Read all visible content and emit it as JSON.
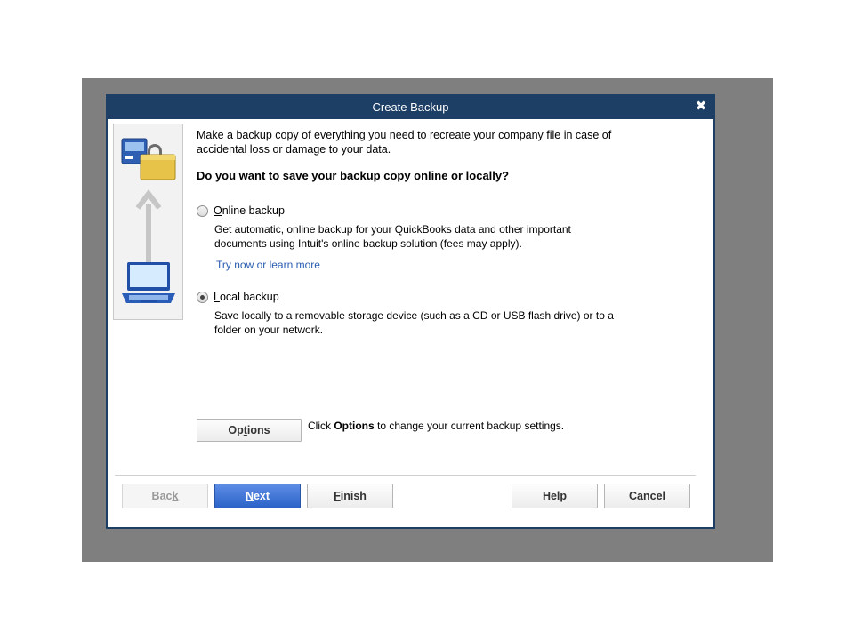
{
  "dialog": {
    "title": "Create Backup",
    "close_glyph": "✖"
  },
  "content": {
    "intro": "Make a backup copy of everything you need to recreate your company file in case of accidental loss or damage to your data.",
    "question": "Do you want to save your backup copy online or locally?",
    "online": {
      "label_key": "O",
      "label_rest": "nline backup",
      "description": "Get automatic, online backup for your QuickBooks data and other important documents using Intuit's online backup solution (fees may apply).",
      "link": "Try now or learn more",
      "selected": false
    },
    "local": {
      "label_key": "L",
      "label_rest": "ocal backup",
      "description": "Save locally to a removable storage device (such as a CD or USB flash drive) or to a folder on your network.",
      "selected": true
    },
    "options_button": {
      "pre": "Op",
      "key": "t",
      "post": "ions"
    },
    "options_note": {
      "pre": "Click ",
      "bold": "Options",
      "post": " to change your current backup settings."
    }
  },
  "footer": {
    "back": {
      "pre": "Bac",
      "key": "k",
      "post": ""
    },
    "next": {
      "pre": "",
      "key": "N",
      "post": "ext"
    },
    "finish": {
      "pre": "",
      "key": "F",
      "post": "inish"
    },
    "help": "Help",
    "cancel": "Cancel"
  },
  "icons": {
    "computer": "computer-icon",
    "lock": "lock-icon",
    "arrow": "arrow-up-icon",
    "laptop": "laptop-icon"
  },
  "colors": {
    "titlebar": "#1d3f66",
    "primary_button": "#2c62c8",
    "link": "#2a5db0",
    "backdrop": "#7f7f7f"
  }
}
